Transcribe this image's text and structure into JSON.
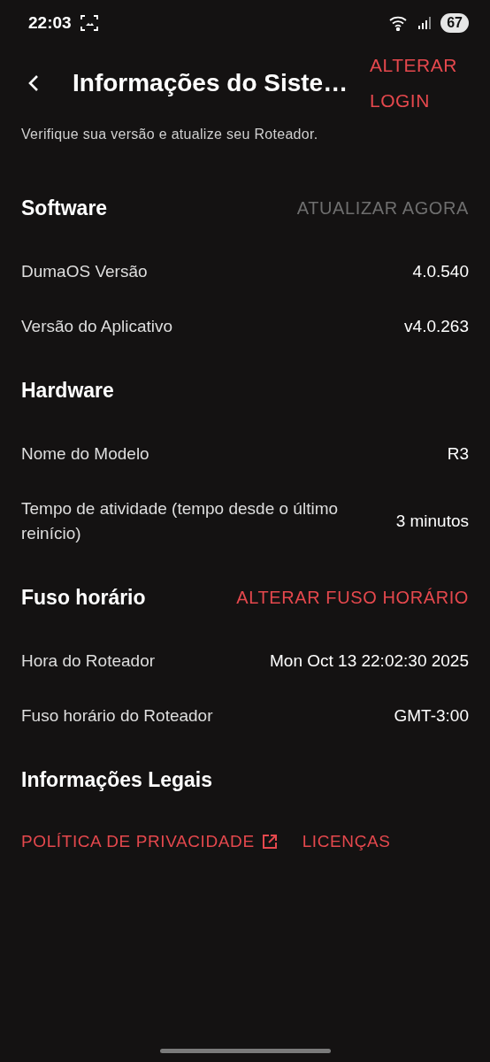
{
  "status_bar": {
    "time": "22:03",
    "battery": "67"
  },
  "header": {
    "title": "Informações do Siste…",
    "action": "ALTERAR LOGIN"
  },
  "subtitle": "Verifique sua versão e atualize seu Roteador.",
  "sections": [
    {
      "title": "Software",
      "action": {
        "label": "ATUALIZAR AGORA",
        "disabled": true
      },
      "rows": [
        {
          "label": "DumaOS Versão",
          "value": "4.0.540"
        },
        {
          "label": "Versão do Aplicativo",
          "value": "v4.0.263"
        }
      ]
    },
    {
      "title": "Hardware",
      "rows": [
        {
          "label": "Nome do Modelo",
          "value": "R3"
        },
        {
          "label": "Tempo de atividade (tempo desde o último reinício)",
          "value": "3 minutos"
        }
      ]
    },
    {
      "title": "Fuso horário",
      "action": {
        "label": "ALTERAR FUSO HORÁRIO",
        "disabled": false
      },
      "rows": [
        {
          "label": "Hora do Roteador",
          "value": "Mon Oct 13 22:02:30 2025"
        },
        {
          "label": "Fuso horário do Roteador",
          "value": "GMT-3:00"
        }
      ]
    },
    {
      "title": "Informações Legais",
      "links": [
        {
          "label": "POLÍTICA DE PRIVACIDADE",
          "external": true
        },
        {
          "label": "LICENÇAS",
          "external": false
        }
      ]
    }
  ]
}
